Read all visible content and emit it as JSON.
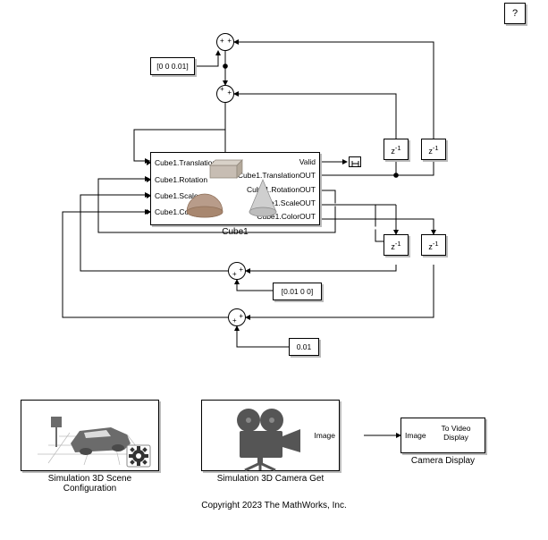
{
  "help": {
    "label": "?"
  },
  "constants": {
    "c1": "[0 0 0.01]",
    "c2": "[0.01 0 0]",
    "c3": "0.01"
  },
  "delays": {
    "d1": "z",
    "d2": "z",
    "d3": "z",
    "d4": "z",
    "exp": "-1"
  },
  "cube1": {
    "title": "Cube1",
    "in_ports": [
      "Cube1.Translation",
      "Cube1.Rotation",
      "Cube1.Scale",
      "Cube1.Color"
    ],
    "out_ports": [
      "Valid",
      "Cube1.TranslationOUT",
      "Cube1.RotationOUT",
      "Cube1.ScaleOUT",
      "Cube1.ColorOUT"
    ]
  },
  "bottom": {
    "scene": {
      "caption": "Simulation 3D Scene Configuration"
    },
    "camera": {
      "caption": "Simulation 3D Camera Get",
      "out": "Image"
    },
    "display": {
      "caption": "Camera Display",
      "in": "Image",
      "line1": "To Video",
      "line2": "Display"
    }
  },
  "footer": "Copyright 2023 The MathWorks, Inc."
}
